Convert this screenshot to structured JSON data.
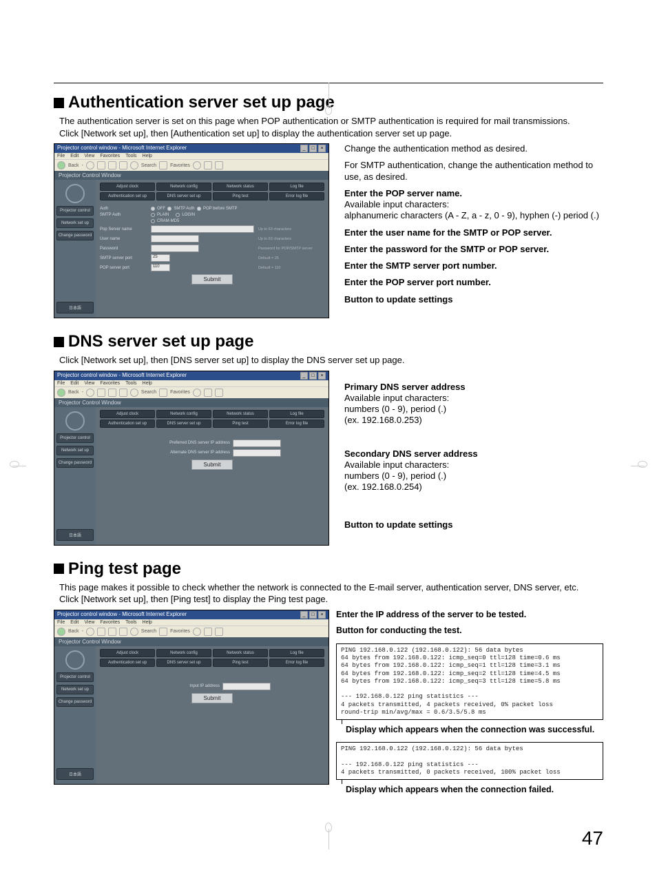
{
  "page_number": "47",
  "browser": {
    "title": "Projector control window - Microsoft Internet Explorer",
    "menu": [
      "File",
      "Edit",
      "View",
      "Favorites",
      "Tools",
      "Help"
    ],
    "toolbar": {
      "back": "Back",
      "search": "Search",
      "favorites": "Favorites"
    },
    "projector_control_window": "Projector Control Window",
    "side": {
      "projector_control": "Projector control",
      "network_setup": "Network set up",
      "change_password": "Change password",
      "japanese": "日本語"
    },
    "tabs": {
      "adjust_clock": "Adjust clock",
      "network_config": "Network config",
      "network_status": "Network status",
      "log_file": "Log file",
      "auth_setup": "Authentication set up",
      "dns_setup": "DNS server set up",
      "ping_test": "Ping test",
      "error_log": "Error log file"
    }
  },
  "sections": {
    "auth": {
      "heading": "Authentication server set up page",
      "intro": "The authentication server is set on this page when POP authentication or SMTP authentication is required for mail transmissions.\nClick [Network set up], then [Authentication set up] to display the authentication server set up page.",
      "fields": {
        "auth": "Auth",
        "off": "OFF",
        "smtp_auth": "SMTP Auth",
        "pop_before_smtp": "POP before SMTP",
        "smtp_auth_lbl": "SMTP Auth",
        "plain": "PLAIN",
        "login": "LOGIN",
        "cram_md5": "CRAM-MD5",
        "pop_server_name": "Pop Server name",
        "pop_server_note": "Up to 63 characters",
        "user_name": "User name",
        "user_name_note": "Up to 63 characters",
        "password": "Password",
        "password_note": "Password for POP/SMTP server",
        "smtp_port": "SMTP server port",
        "smtp_port_val": "25",
        "smtp_port_note": "Default = 25",
        "pop_port": "POP server port",
        "pop_port_val": "110",
        "pop_port_note": "Default = 110",
        "submit": "Submit"
      },
      "callouts": {
        "c1": "Change the authentication method as desired.",
        "c2": "For SMTP authentication, change the authentication method to use, as desired.",
        "c3a": "Enter the POP server name.",
        "c3b": "Available input characters:",
        "c3c": "alphanumeric characters (A - Z, a - z, 0 - 9), hyphen (-) period (.)",
        "c4": "Enter the user name for the SMTP or POP server.",
        "c5": "Enter the password for the SMTP or POP server.",
        "c6": "Enter the SMTP server port number.",
        "c7": "Enter the POP server port number.",
        "c8": "Button to update settings"
      }
    },
    "dns": {
      "heading": "DNS server set up page",
      "intro": "Click [Network set up], then [DNS server set up] to display the DNS server set up page.",
      "fields": {
        "pref": "Preferred DNS server IP address",
        "alt": "Alternate DNS server IP address",
        "submit": "Submit"
      },
      "callouts": {
        "c1a": "Primary DNS server address",
        "c1b": "Available input characters:",
        "c1c": "numbers (0 - 9), period (.)",
        "c1d": "(ex. 192.168.0.253)",
        "c2a": "Secondary DNS server address",
        "c2b": "Available input characters:",
        "c2c": "numbers (0 - 9), period (.)",
        "c2d": "(ex. 192.168.0.254)",
        "c3": "Button to update settings"
      }
    },
    "ping": {
      "heading": "Ping test page",
      "intro": "This page makes it possible to check whether the network is connected to the E-mail server, authentication server, DNS server, etc.\nClick [Network set up], then [Ping test] to display the Ping test page.",
      "fields": {
        "input_ip": "Input IP address",
        "submit": "Submit"
      },
      "callouts": {
        "c1": "Enter the IP address of the server to be tested.",
        "c2": "Button for conducting the test."
      },
      "term_ok": "PING 192.168.0.122 (192.168.0.122): 56 data bytes\n64 bytes from 192.168.0.122: icmp_seq=0 ttl=128 time=0.6 ms\n64 bytes from 192.168.0.122: icmp_seq=1 ttl=128 time=3.1 ms\n64 bytes from 192.168.0.122: icmp_seq=2 ttl=128 time=4.5 ms\n64 bytes from 192.168.0.122: icmp_seq=3 ttl=128 time=5.8 ms\n\n--- 192.168.0.122 ping statistics ---\n4 packets transmitted, 4 packets received, 0% packet loss\nround-trip min/avg/max = 0.6/3.5/5.8 ms",
      "term_ok_label": "Display which appears when the connection was successful.",
      "term_fail": "PING 192.168.0.122 (192.168.0.122): 56 data bytes\n\n--- 192.168.0.122 ping statistics ---\n4 packets transmitted, 0 packets received, 100% packet loss",
      "term_fail_label": "Display which appears when the connection failed."
    }
  }
}
